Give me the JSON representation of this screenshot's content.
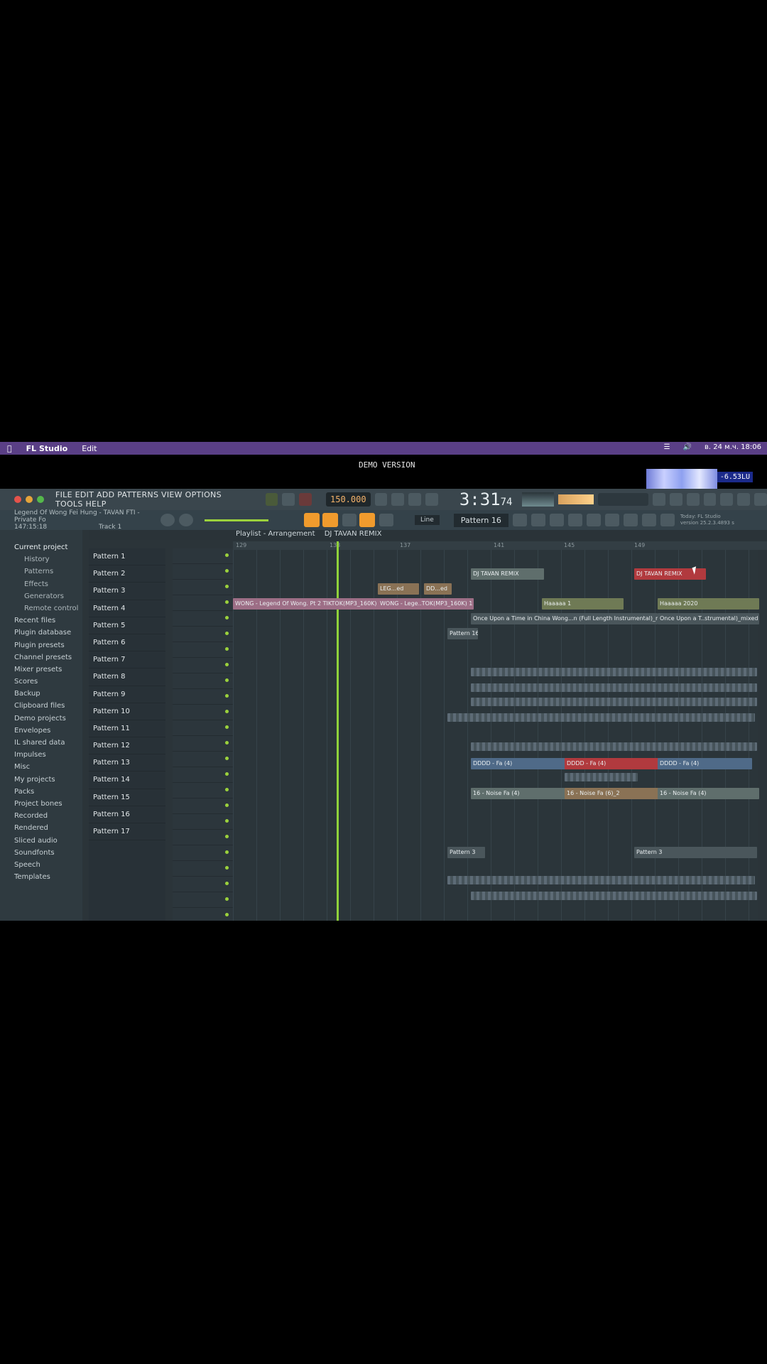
{
  "macbar": {
    "app": "FL Studio",
    "menu_edit": "Edit",
    "datetime": "в. 24 м.ч. 18:06"
  },
  "demo_label": "DEMO VERSION",
  "db_meter": "-6.53LU",
  "fl_menu": "FILE EDIT ADD PATTERNS VIEW OPTIONS TOOLS HELP",
  "tempo": "150.000",
  "time": "3:31",
  "time_ms": "74",
  "song": {
    "title": "Legend Of Wong Fei Hung - TAVAN FTI - Private Fo",
    "position": "147:15:18",
    "track": "Track 1"
  },
  "snap": "Line",
  "pattern_selected": "Pattern 16",
  "today_info": "Today: FL Studio version 25.2.3.4893 s",
  "playlist_title": "Playlist - Arrangement",
  "arrangement": "DJ TAVAN REMIX",
  "browser": [
    {
      "label": "Current project",
      "type": "head"
    },
    {
      "label": "History",
      "type": "sub"
    },
    {
      "label": "Patterns",
      "type": "sub"
    },
    {
      "label": "Effects",
      "type": "sub"
    },
    {
      "label": "Generators",
      "type": "sub"
    },
    {
      "label": "Remote control",
      "type": "sub"
    },
    {
      "label": "Recent files",
      "type": "item"
    },
    {
      "label": "Plugin database",
      "type": "item"
    },
    {
      "label": "Plugin presets",
      "type": "item"
    },
    {
      "label": "Channel presets",
      "type": "item"
    },
    {
      "label": "Mixer presets",
      "type": "item"
    },
    {
      "label": "Scores",
      "type": "item"
    },
    {
      "label": "Backup",
      "type": "item"
    },
    {
      "label": "Clipboard files",
      "type": "item"
    },
    {
      "label": "Demo projects",
      "type": "item"
    },
    {
      "label": "Envelopes",
      "type": "item"
    },
    {
      "label": "IL shared data",
      "type": "item"
    },
    {
      "label": "Impulses",
      "type": "item"
    },
    {
      "label": "Misc",
      "type": "item"
    },
    {
      "label": "My projects",
      "type": "item"
    },
    {
      "label": "Packs",
      "type": "item"
    },
    {
      "label": "Project bones",
      "type": "item"
    },
    {
      "label": "Recorded",
      "type": "item"
    },
    {
      "label": "Rendered",
      "type": "item"
    },
    {
      "label": "Sliced audio",
      "type": "item"
    },
    {
      "label": "Soundfonts",
      "type": "item"
    },
    {
      "label": "Speech",
      "type": "item"
    },
    {
      "label": "Templates",
      "type": "item"
    }
  ],
  "patterns": [
    "Pattern 1",
    "Pattern 2",
    "Pattern 3",
    "Pattern 4",
    "Pattern 5",
    "Pattern 6",
    "Pattern 7",
    "Pattern 8",
    "Pattern 9",
    "Pattern 10",
    "Pattern 11",
    "Pattern 12",
    "Pattern 13",
    "Pattern 14",
    "Pattern 15",
    "Pattern 16",
    "Pattern 17"
  ],
  "ruler": [
    "129",
    "",
    "",
    "",
    "133",
    "",
    "",
    "137",
    "",
    "",
    "",
    "141",
    "",
    "",
    "145",
    "",
    "",
    "149"
  ],
  "clips": [
    {
      "label": "DJ TAVAN REMIX",
      "cls": "c-grey"
    },
    {
      "label": "DJ TAVAN REMIX",
      "cls": "c-red"
    },
    {
      "label": "LEG...ed",
      "cls": "c-brown"
    },
    {
      "label": "DD...ed",
      "cls": "c-brown"
    },
    {
      "label": "WONG - Legend Of Wong. Pt 2 TIKTOK(MP3_160K) 1",
      "cls": "c-pink"
    },
    {
      "label": "WONG - Lege..TOK(MP3_160K) 1",
      "cls": "c-pink"
    },
    {
      "label": "Haaaaa 1",
      "cls": "c-olive"
    },
    {
      "label": "Haaaaa 2020",
      "cls": "c-olive"
    },
    {
      "label": "Once Upon a Time in China Wong...n (Full Length Instrumental)_mixed",
      "cls": "c-dark"
    },
    {
      "label": "Once Upon a T..strumental)_mixed",
      "cls": "c-dark"
    },
    {
      "label": "Pattern 16",
      "cls": "c-dark"
    },
    {
      "label": "DDDD - Fa (4)",
      "cls": "c-blue"
    },
    {
      "label": "DDDD - Fa (4)",
      "cls": "c-red"
    },
    {
      "label": "DDDD - Fa (4)",
      "cls": "c-blue"
    },
    {
      "label": "16 - Noise Fa (4)",
      "cls": "c-grey"
    },
    {
      "label": "16 - Noise Fa (6)_2",
      "cls": "c-brown"
    },
    {
      "label": "16 - Noise Fa (4)",
      "cls": "c-grey"
    },
    {
      "label": "Pattern 3",
      "cls": "c-dark"
    },
    {
      "label": "Pattern 3",
      "cls": "c-dark"
    }
  ]
}
